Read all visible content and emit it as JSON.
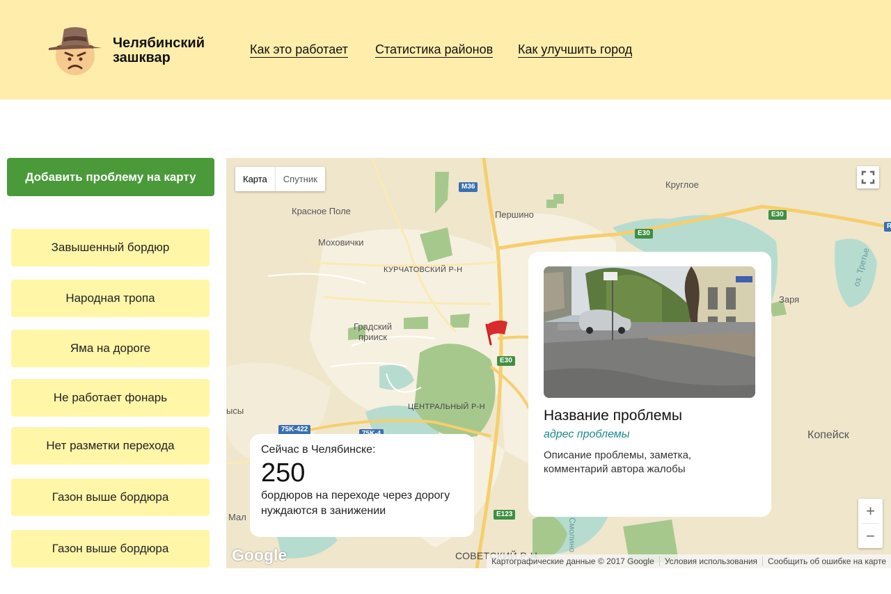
{
  "header": {
    "brand_line1": "Челябинский",
    "brand_line2": "зашквар",
    "nav": [
      {
        "label": "Как это работает"
      },
      {
        "label": "Статистика районов"
      },
      {
        "label": "Как улучшить город"
      }
    ]
  },
  "sidebar": {
    "add_button": "Добавить проблему на карту",
    "categories": [
      {
        "label": "Завышенный бордюр"
      },
      {
        "label": "Народная тропа"
      },
      {
        "label": "Яма на дороге"
      },
      {
        "label": "Не работает фонарь"
      },
      {
        "label": "Нет разметки перехода"
      },
      {
        "label": "Газон выше бордюра"
      },
      {
        "label": "Газон выше бордюра"
      }
    ]
  },
  "map": {
    "type_buttons": {
      "map": "Карта",
      "satellite": "Спутник"
    },
    "labels": {
      "krasnoe_pole": "Красное Поле",
      "pershino": "Першино",
      "krugloe": "Круглое",
      "mohovichki": "Моховички",
      "kurchatovsky": "КУРЧАТОВСКИЙ Р-Н",
      "gradsky1": "Градский",
      "gradsky2": "прииск",
      "tsentralny": "ЦЕНТРАЛЬНЫЙ Р-Н",
      "sovetsky": "СОВЕТСКИЙ Р-Н",
      "zarya": "Заря",
      "kopeysk": "Копейск",
      "oz_tretye": "оз. Третье",
      "smolino": "Смолино",
      "ysy": "ысы",
      "maly": "Мал"
    },
    "shields": {
      "m36": "M36",
      "e30_a": "E30",
      "e30_b": "E30",
      "e30_c": "E30",
      "e123": "E123",
      "r75k": "75K-422",
      "r75k2": "75K-4",
      "r": "R"
    },
    "google": "Google",
    "attribution": [
      "Картографические данные © 2017 Google",
      "Условия использования",
      "Сообщить об ошибке на карте"
    ],
    "zoom_in": "+",
    "zoom_out": "−"
  },
  "stats": {
    "intro": "Сейчас в Челябинске:",
    "count": "250",
    "line1": "бордюров на переходе через дорогу",
    "line2": "нуждаются в занижении"
  },
  "problem": {
    "title": "Название проблемы",
    "address": "адрес проблемы",
    "description_line1": "Описание проблемы, заметка,",
    "description_line2": "комментарий автора жалобы"
  },
  "colors": {
    "header_bg": "#ffeeab",
    "add_button_bg": "#4a9a3a",
    "category_bg": "#fff6a8",
    "address_color": "#1a8a8a",
    "flag": "#d62c2c"
  }
}
